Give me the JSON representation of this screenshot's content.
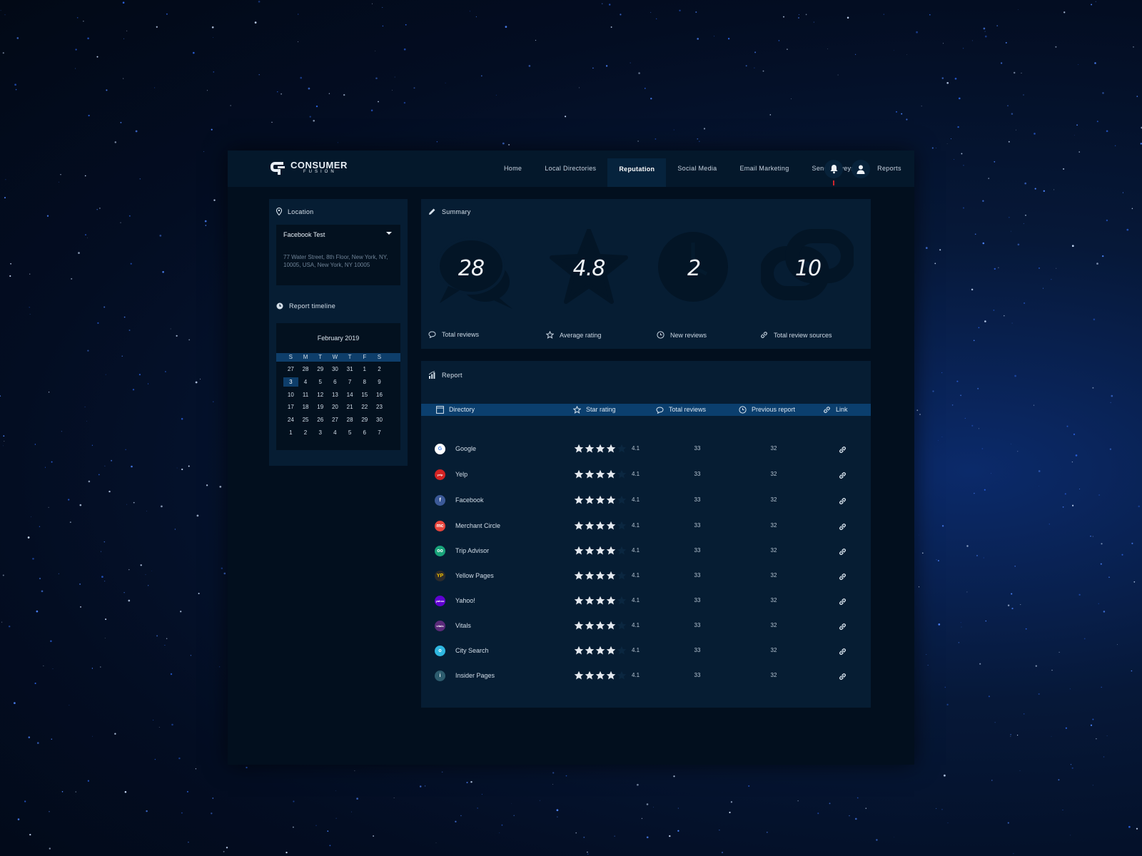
{
  "colors": {
    "accent": "#0b3f6e",
    "panel": "#061d33",
    "frame": "#020f1e",
    "alert": "#d0252c"
  },
  "brand": {
    "name": "CONSUMER",
    "sub": "FUSION"
  },
  "nav": {
    "items": [
      {
        "label": "Home"
      },
      {
        "label": "Local Directories"
      },
      {
        "label": "Reputation",
        "active": true
      },
      {
        "label": "Social Media"
      },
      {
        "label": "Email Marketing"
      },
      {
        "label": "Send Surveys"
      },
      {
        "label": "Reports"
      }
    ],
    "icons": [
      "bell-icon",
      "user-icon"
    ]
  },
  "location": {
    "title": "Location",
    "selected": "Facebook Test",
    "address": "77 Water Street, 8th Floor, New York, NY, 10005, USA, New York, NY 10005"
  },
  "timeline": {
    "title": "Report timeline",
    "month": "February 2019",
    "weekdays": [
      "S",
      "M",
      "T",
      "W",
      "T",
      "F",
      "S"
    ],
    "weeks": [
      [
        "27",
        "28",
        "29",
        "30",
        "31",
        "1",
        "2"
      ],
      [
        "3",
        "4",
        "5",
        "6",
        "7",
        "8",
        "9"
      ],
      [
        "10",
        "11",
        "12",
        "13",
        "14",
        "15",
        "16"
      ],
      [
        "17",
        "18",
        "19",
        "20",
        "21",
        "22",
        "23"
      ],
      [
        "24",
        "25",
        "26",
        "27",
        "28",
        "29",
        "30"
      ],
      [
        "1",
        "2",
        "3",
        "4",
        "5",
        "6",
        "7"
      ]
    ],
    "selected_day": "3"
  },
  "summary": {
    "title": "Summary",
    "stats": [
      {
        "value": "28",
        "label": "Total reviews",
        "icon": "chat-icon"
      },
      {
        "value": "4.8",
        "label": "Average rating",
        "icon": "star-icon"
      },
      {
        "value": "2",
        "label": "New reviews",
        "icon": "clock-icon"
      },
      {
        "value": "10",
        "label": "Total review sources",
        "icon": "link-icon"
      }
    ]
  },
  "report": {
    "title": "Report",
    "columns": {
      "directory": "Directory",
      "star_rating": "Star rating",
      "total_reviews": "Total reviews",
      "previous_report": "Previous report",
      "link": "Link"
    },
    "rows": [
      {
        "name": "Google",
        "rating": "4.1",
        "stars": 4,
        "total": "33",
        "previous": "32",
        "logo": "G",
        "logo_color": "#ffffff",
        "logo_text": "#4285f4"
      },
      {
        "name": "Yelp",
        "rating": "4.1",
        "stars": 4,
        "total": "33",
        "previous": "32",
        "logo": "yelp",
        "logo_color": "#d32323",
        "logo_text": "#ffffff"
      },
      {
        "name": "Facebook",
        "rating": "4.1",
        "stars": 4,
        "total": "33",
        "previous": "32",
        "logo": "f",
        "logo_color": "#3b5998",
        "logo_text": "#ffffff"
      },
      {
        "name": "Merchant Circle",
        "rating": "4.1",
        "stars": 4,
        "total": "33",
        "previous": "32",
        "logo": "mc",
        "logo_color": "#e8453c",
        "logo_text": "#ffffff"
      },
      {
        "name": "Trip Advisor",
        "rating": "4.1",
        "stars": 4,
        "total": "33",
        "previous": "32",
        "logo": "oo",
        "logo_color": "#18a37a",
        "logo_text": "#ffffff"
      },
      {
        "name": "Yellow Pages",
        "rating": "4.1",
        "stars": 4,
        "total": "33",
        "previous": "32",
        "logo": "YP",
        "logo_color": "#2b2b2b",
        "logo_text": "#f5c400"
      },
      {
        "name": "Yahoo!",
        "rating": "4.1",
        "stars": 4,
        "total": "33",
        "previous": "32",
        "logo": "yahoo",
        "logo_color": "#5f01d1",
        "logo_text": "#ffffff"
      },
      {
        "name": "Vitals",
        "rating": "4.1",
        "stars": 4,
        "total": "33",
        "previous": "32",
        "logo": "vitals",
        "logo_color": "#5b2a7a",
        "logo_text": "#ffffff"
      },
      {
        "name": "City Search",
        "rating": "4.1",
        "stars": 4,
        "total": "33",
        "previous": "32",
        "logo": "o",
        "logo_color": "#2fb7e0",
        "logo_text": "#ffffff"
      },
      {
        "name": "Insider Pages",
        "rating": "4.1",
        "stars": 4,
        "total": "33",
        "previous": "32",
        "logo": "i",
        "logo_color": "#2d5c6e",
        "logo_text": "#ffffff"
      }
    ]
  }
}
